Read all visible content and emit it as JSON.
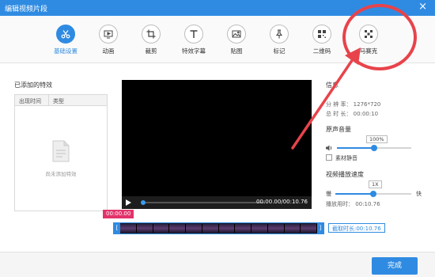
{
  "window": {
    "title": "编辑视频片段",
    "close": "×"
  },
  "toolbar": {
    "tools": [
      {
        "label": "基础设置",
        "icon": "scissors-icon",
        "active": true
      },
      {
        "label": "动画",
        "icon": "play-screen-icon"
      },
      {
        "label": "裁剪",
        "icon": "crop-icon"
      },
      {
        "label": "特效字幕",
        "icon": "text-icon"
      },
      {
        "label": "贴图",
        "icon": "image-icon"
      },
      {
        "label": "标记",
        "icon": "pin-icon"
      },
      {
        "label": "二维码",
        "icon": "qrcode-icon"
      },
      {
        "label": "马赛克",
        "icon": "mosaic-icon"
      }
    ]
  },
  "effects": {
    "title": "已添加的特效",
    "col_time": "出现时间",
    "col_type": "类型",
    "empty_text": "尚未添加特效"
  },
  "player": {
    "time": "00:00.00/00:10.76",
    "progress": 0
  },
  "timeline": {
    "start": "00:00.00",
    "cut_length": "截取时长:00:10.76",
    "frame_count": 12
  },
  "info": {
    "title": "信息",
    "resolution": "分 辨 率：  1276*720",
    "duration": "总 时 长：  00:00:10"
  },
  "audio": {
    "title": "原声音量",
    "volume": "100%",
    "volume_fraction": 0.5,
    "mute_label": "素材静音"
  },
  "speed": {
    "title": "视频播放速度",
    "value": "1X",
    "fraction": 0.5,
    "slow": "慢",
    "fast": "快",
    "play_time": "播放用时：  00:10.76"
  },
  "footer": {
    "done": "完成"
  },
  "colors": {
    "accent": "#2f8be2",
    "annotation": "#e8434b",
    "start_badge": "#e2336b"
  }
}
